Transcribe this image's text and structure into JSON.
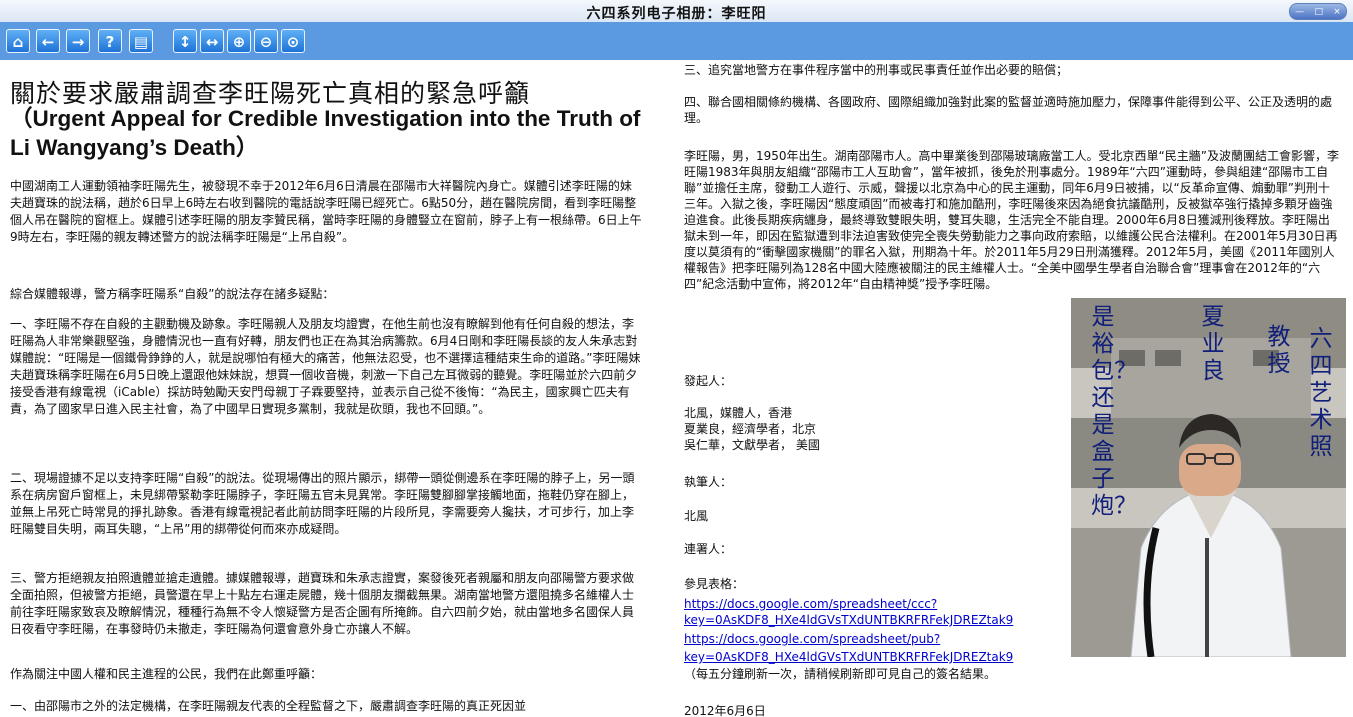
{
  "window": {
    "title": "六四系列电子相册：李旺阳",
    "controls": [
      "—",
      "□",
      "×"
    ]
  },
  "toolbar": {
    "buttons": [
      {
        "name": "home-button",
        "glyph": "⌂"
      },
      {
        "name": "back-button",
        "glyph": "←"
      },
      {
        "name": "forward-button",
        "glyph": "→"
      },
      {
        "name": "help-button",
        "glyph": "?"
      },
      {
        "name": "page-layout-button",
        "glyph": "▤"
      },
      {
        "name": "fit-height-button",
        "glyph": "↕"
      },
      {
        "name": "fit-width-button",
        "glyph": "↔"
      },
      {
        "name": "zoom-in-button",
        "glyph": "⊕"
      },
      {
        "name": "zoom-out-button",
        "glyph": "⊖"
      },
      {
        "name": "zoom-actual-button",
        "glyph": "⊙"
      }
    ]
  },
  "left_page": {
    "heading_zh": "關於要求嚴肅調查李旺陽死亡真相的緊急呼籲",
    "heading_en": "（Urgent Appeal for Credible Investigation into the Truth of Li Wangyang’s Death）",
    "p1": "中國湖南工人運動領袖李旺陽先生，被發現不幸于2012年6月6日清晨在邵陽市大祥醫院內身亡。媒體引述李旺陽的妹夫趙寶珠的說法稱，趙於6日早上6時左右收到醫院的電話說李旺陽已經死亡。6點50分，趙在醫院房間，看到李旺陽整個人吊在醫院的窗框上。媒體引述李旺陽的朋友李贊民稱，當時李旺陽的身體豎立在窗前，脖子上有一根絲帶。6日上午9時左右，李旺陽的親友轉述警方的說法稱李旺陽是“上吊自殺”。",
    "p2": "綜合媒體報導，警方稱李旺陽系“自殺”的說法存在諸多疑點：",
    "p3": "一、李旺陽不存在自殺的主觀動機及跡象。李旺陽親人及朋友均證實，在他生前也沒有瞭解到他有任何自殺的想法，李旺陽為人非常樂觀堅強，身體情況也一直有好轉，朋友們也正在為其治病籌款。6月4日剛和李旺陽長談的友人朱承志對媒體說：“旺陽是一個鐵骨錚錚的人，就是說哪怕有極大的痛苦，他無法忍受，也不選擇這種結束生命的道路。”李旺陽妹夫趙寶珠稱李旺陽在6月5日晚上還跟他妹妹說，想買一個收音機，刺激一下自己左耳微弱的聽覺。李旺陽並於六四前夕接受香港有線電視（iCable）採訪時勉勵天安門母親丁子霖要堅持，並表示自己從不後悔：“為民主，國家興亡匹夫有責，為了國家早日進入民主社會，為了中國早日實現多黨制，我就是砍頭，我也不回頭。”。",
    "p4": "二、現場證據不足以支持李旺陽“自殺”的說法。從現場傳出的照片顯示，綁帶一頭從側邊系在李旺陽的脖子上，另一頭系在病房窗戶窗框上，未見綁帶緊勒李旺陽脖子，李旺陽五官未見異常。李旺陽雙腳腳掌接觸地面，拖鞋仍穿在腳上，並無上吊死亡時常見的掙扎跡象。香港有線電視記者此前訪問李旺陽的片段所見，李需要旁人攙扶，才可步行，加上李旺陽雙目失明，兩耳失聰，“上吊”用的綁帶從何而來亦成疑問。",
    "p5": "三、警方拒絕親友拍照遺體並搶走遺體。據媒體報導，趙寶珠和朱承志證實，案發後死者親屬和朋友向邵陽警方要求做全面拍照，但被警方拒絕，員警還在早上十點左右運走屍體，幾十個朋友攔截無果。湖南當地警方還阻撓多名維權人士前往李旺陽家致哀及瞭解情況，種種行為無不令人懷疑警方是否企圖有所掩飾。自六四前夕始，就由當地多名國保人員日夜看守李旺陽，在事發時仍未撤走，李旺陽為何還會意外身亡亦讓人不解。",
    "p6": "作為關注中國人權和民主進程的公民，我們在此鄭重呼籲：",
    "p7": "一、由邵陽市之外的法定機構，在李旺陽親友代表的全程監督之下，嚴肅調查李旺陽的真正死因並"
  },
  "right_page": {
    "r1": "三、追究當地警方在事件程序當中的刑事或民事責任並作出必要的賠償；",
    "r2": "四、聯合國相關條約機構、各國政府、國際組織加強對此案的監督並適時施加壓力，保障事件能得到公平、公正及透明的處理。",
    "r3": "李旺陽，男，1950年出生。湖南邵陽市人。高中畢業後到邵陽玻璃廠當工人。受北京西單“民主牆”及波蘭團結工會影響，李旺陽1983年與朋友組織“邵陽市工人互助會”，當年被抓，後免於刑事處分。1989年“六四”運動時，參與組建“邵陽市工自聯”並擔任主席，發動工人遊行、示威，聲援以北京為中心的民主運動，同年6月9日被捕，以“反革命宣傳、煽動罪”判刑十三年。入獄之後，李旺陽因“態度頑固”而被毒打和施加酷刑，李旺陽後來因為絕食抗議酷刑，反被獄卒強行撬掉多顆牙齒強迫進食。此後長期疾病纏身，最終導致雙眼失明，雙耳失聰，生活完全不能自理。2000年6月8日獲減刑後釋放。李旺陽出獄未到一年，即因在監獄遭到非法迫害致使完全喪失勞動能力之事向政府索賠，以維護公民合法權利。在2001年5月30日再度以莫須有的“衝擊國家機關”的罪名入獄，刑期為十年。於2011年5月29日刑滿獲釋。2012年5月，美國《2011年國別人權報告》把李旺陽列為128名中國大陸應被關注的民主維權人士。“全美中國學生學者自治聯合會”理事會在2012年的“六四”紀念活動中宣佈，將2012年“自由精神獎”授予李旺陽。",
    "sponsors_label": "發起人：",
    "sponsor_1": "北風，媒體人，香港",
    "sponsor_2": "夏業良，經濟學者，北京",
    "sponsor_3": "吳仁華，文獻學者，  美國",
    "writer_label": "執筆人：",
    "writer": "北風",
    "cosigners_label": "連署人：",
    "form_label": "參見表格：",
    "link1_a": "https://docs.google.com/spreadsheet/ccc?",
    "link1_b": "key=0AsKDF8_HXe4ldGVsTXdUNTBKRFRFekJDREZtak9",
    "link2_a": "https://docs.google.com/spreadsheet/pub?",
    "link2_b": "key=0AsKDF8_HXe4ldGVsTXdUNTBKRFRFekJDREZtak9",
    "refresh_note": "（每五分鐘刷新一次，請稍候刷新即可見自己的簽名結果。",
    "date": "2012年6月6日"
  },
  "photo_caption": {
    "col_left": "是裕包？还是盒子炮？",
    "col_name": "夏业良",
    "col_title": "教授",
    "col_series": "六四艺术照"
  },
  "colors": {
    "toolbar": "#5b9ae0",
    "caption": "#101f7a",
    "link": "#0000cc"
  }
}
